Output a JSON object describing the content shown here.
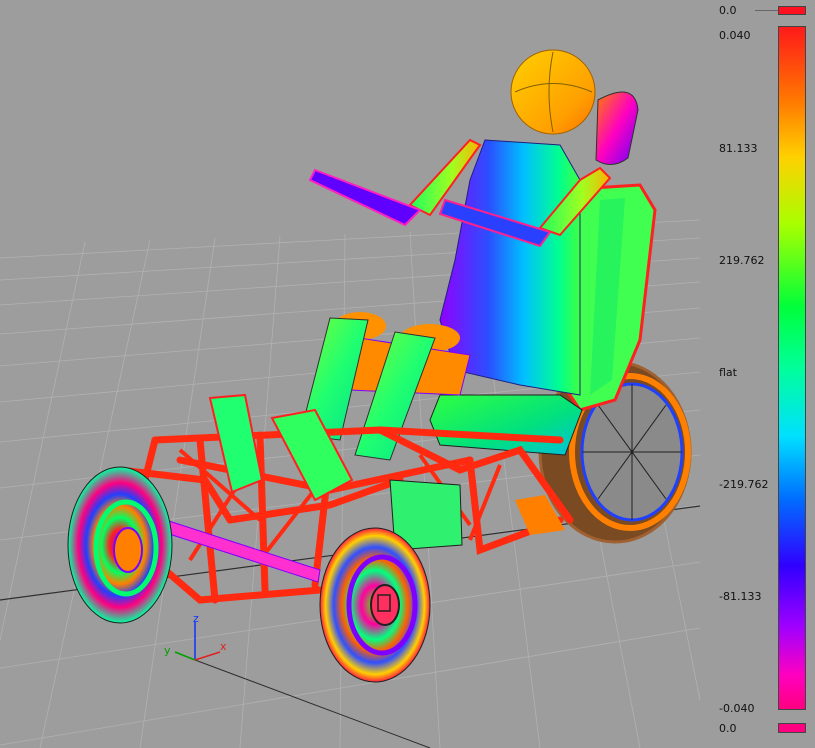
{
  "viewport": {
    "axis_labels": {
      "z": "z",
      "y": "y",
      "x": "x"
    }
  },
  "scale": {
    "top_swatch_label": "0.0",
    "bottom_swatch_label": "0.0",
    "tick_labels": [
      "0.040",
      "81.133",
      "219.762",
      "flat",
      "-219.762",
      "-81.133",
      "-0.040"
    ],
    "colors": {
      "top_swatch": "#ff1020",
      "bottom_swatch": "#ff0080"
    }
  }
}
